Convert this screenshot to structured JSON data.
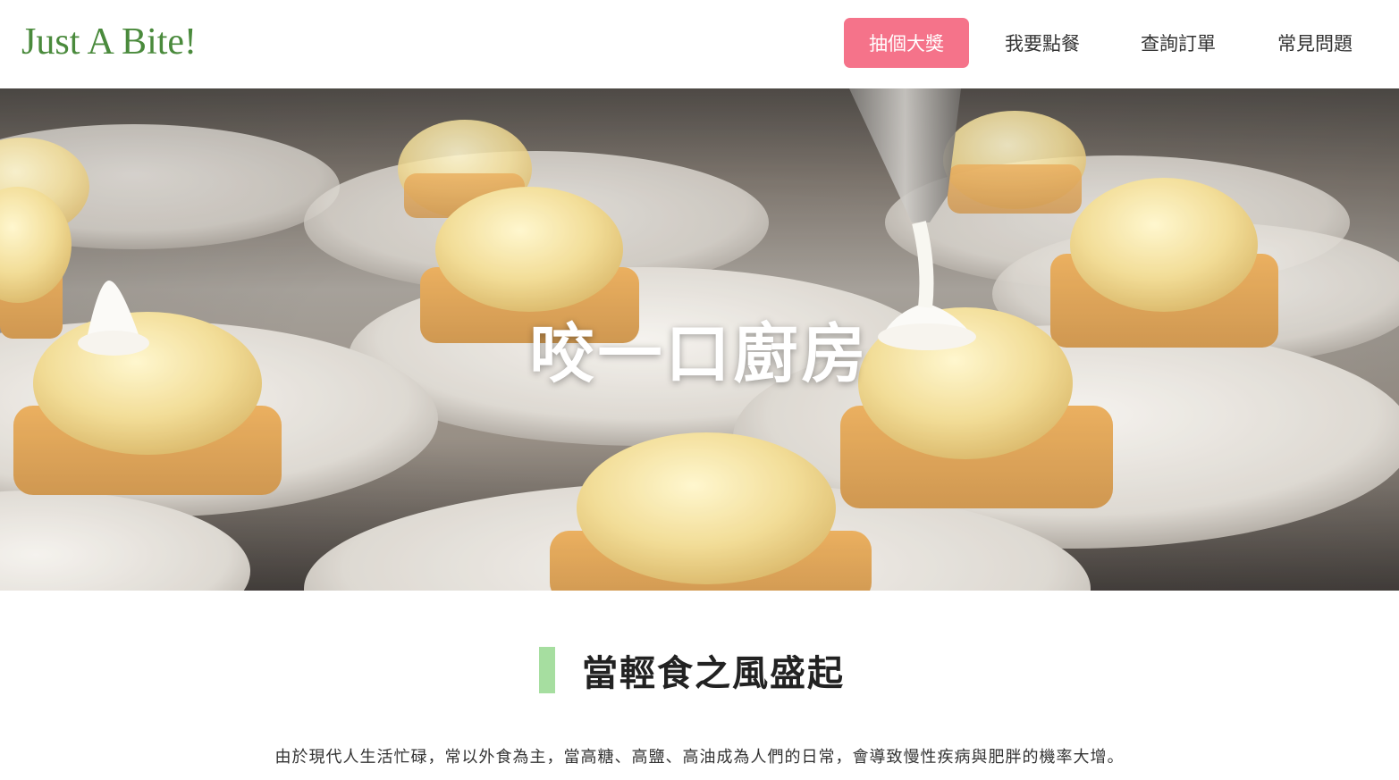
{
  "brand": {
    "name": "Just A Bite!"
  },
  "nav": {
    "lottery": "抽個大獎",
    "order": "我要點餐",
    "query": "查詢訂單",
    "faq": "常見問題"
  },
  "hero": {
    "title": "咬一口廚房",
    "image": "lemon-tarts-with-piping-bag"
  },
  "intro": {
    "heading": "當輕食之風盛起",
    "text": "由於現代人生活忙碌，常以外食為主，當高糖、高鹽、高油成為人們的日常，會導致慢性疾病與肥胖的機率大增。"
  },
  "colors": {
    "brand": "#4a8a3c",
    "accent": "#f5738a",
    "heading_bar": "#a6dea0"
  }
}
